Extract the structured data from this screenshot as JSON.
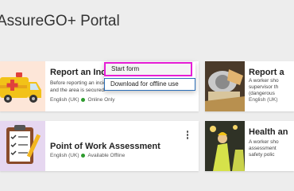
{
  "app": {
    "title": "AssureGO+ Portal"
  },
  "cards": [
    {
      "title": "Report an Incident",
      "description": "Before reporting an incident ensure that everybody are safe and the area is secured.",
      "language": "English (UK)",
      "status": "Online Only",
      "thumbnail_icon": "ambulance-icon"
    },
    {
      "title": "Report a",
      "description_lines": [
        "A worker sho",
        "supervisor th",
        "(dangerous"
      ],
      "language": "English (UK)",
      "thumbnail_icon": "worker-photo"
    },
    {
      "title": "Point of Work Assessment",
      "language": "English (UK)",
      "status": "Available Offline",
      "thumbnail_icon": "checklist-clipboard-icon"
    },
    {
      "title": "Health an",
      "description_lines": [
        "A worker sho",
        "assessment",
        "safety polic"
      ],
      "thumbnail_icon": "site-photo"
    }
  ],
  "context_menu": {
    "items": [
      "Start form",
      "Download for offline use"
    ]
  },
  "colors": {
    "online": "#2e9b2e",
    "highlight": "#e61ed6",
    "focus": "#2c6fb8"
  }
}
